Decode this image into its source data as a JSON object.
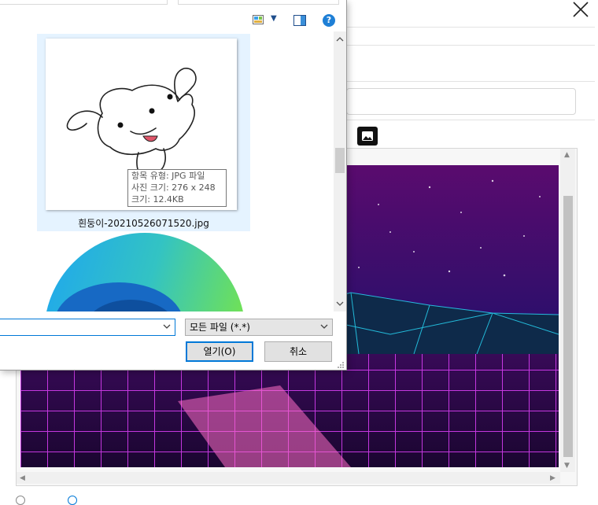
{
  "dialog": {
    "file_items": [
      {
        "name": "흰둥이-20210526071520.jpg"
      },
      {
        "name": ""
      }
    ],
    "tooltip": {
      "type_line": "항목 유형: JPG 파일",
      "dimensions_line": "사진 크기: 276 x 248",
      "size_line": "크기: 12.4KB"
    },
    "filename_value": "",
    "filetype_selected": "모든 파일 (*.*)",
    "open_label": "열기(O)",
    "cancel_label": "취소"
  },
  "icons": {
    "close": "close-icon",
    "image_insert": "image-icon",
    "view_options": "view-options-icon",
    "preview_pane": "preview-pane-icon",
    "help": "help-icon"
  },
  "colors": {
    "accent": "#0078d7",
    "selection": "#e5f3ff",
    "help": "#1e7fd6"
  }
}
